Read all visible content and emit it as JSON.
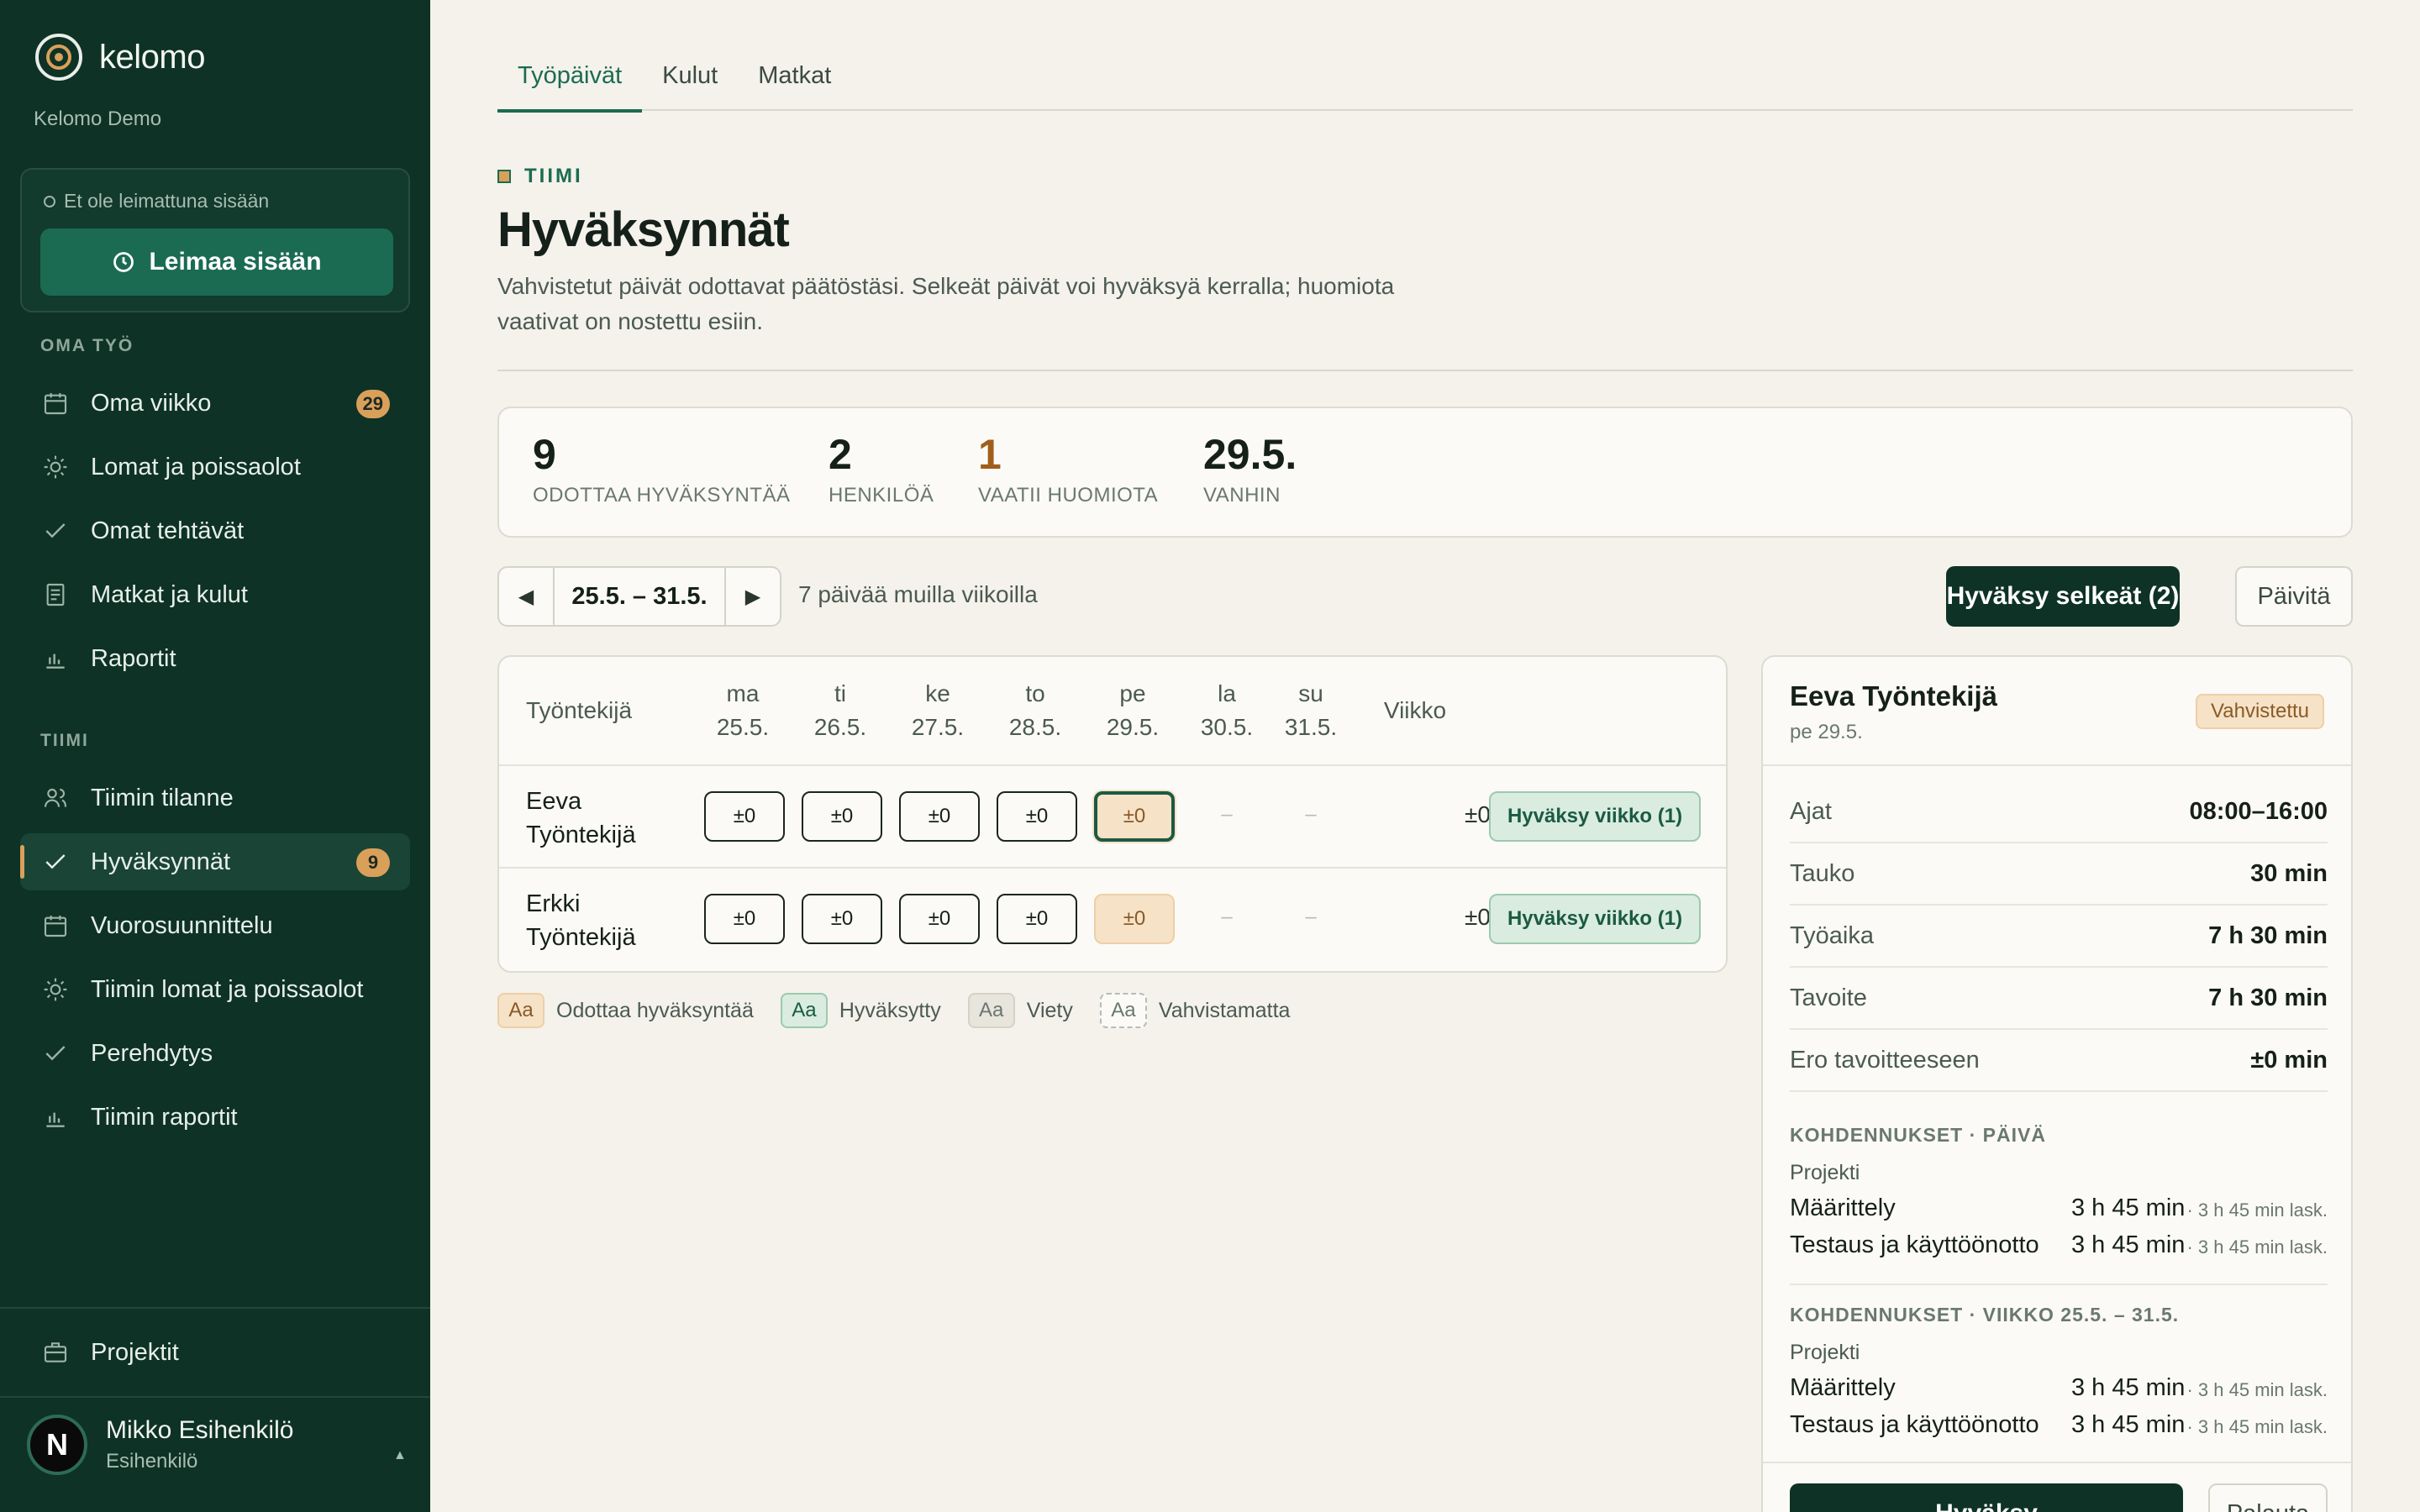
{
  "app": {
    "brand": "kelomo",
    "org": "Kelomo Demo"
  },
  "clock": {
    "status": "Et ole leimattuna sisään",
    "button": "Leimaa sisään"
  },
  "sidebar": {
    "section_own": "OMA TYÖ",
    "own_items": [
      {
        "label": "Oma viikko",
        "icon": "calendar-icon",
        "badge": "29"
      },
      {
        "label": "Lomat ja poissaolot",
        "icon": "sun-icon"
      },
      {
        "label": "Omat tehtävät",
        "icon": "check-icon"
      },
      {
        "label": "Matkat ja kulut",
        "icon": "receipt-icon"
      },
      {
        "label": "Raportit",
        "icon": "bar-chart-icon"
      }
    ],
    "section_team": "TIIMI",
    "team_items": [
      {
        "label": "Tiimin tilanne",
        "icon": "users-icon"
      },
      {
        "label": "Hyväksynnät",
        "icon": "check-icon",
        "badge": "9",
        "active": true
      },
      {
        "label": "Vuorosuunnittelu",
        "icon": "calendar-icon"
      },
      {
        "label": "Tiimin lomat ja poissaolot",
        "icon": "sun-icon"
      },
      {
        "label": "Perehdytys",
        "icon": "check-icon"
      },
      {
        "label": "Tiimin raportit",
        "icon": "bar-chart-icon"
      }
    ],
    "projects": {
      "label": "Projektit",
      "icon": "briefcase-icon"
    },
    "user": {
      "initial": "N",
      "name": "Mikko Esihenkilö",
      "role": "Esihenkilö",
      "caret": "▲"
    }
  },
  "tabs": [
    {
      "label": "Työpäivät",
      "active": true
    },
    {
      "label": "Kulut"
    },
    {
      "label": "Matkat"
    }
  ],
  "header": {
    "kicker": "TIIMI",
    "title": "Hyväksynnät",
    "description": "Vahvistetut päivät odottavat päätöstäsi. Selkeät päivät voi hyväksyä kerralla; huomiota vaativat on nostettu esiin."
  },
  "stats": [
    {
      "value": "9",
      "label": "ODOTTAA HYVÄKSYNTÄÄ"
    },
    {
      "value": "2",
      "label": "HENKILÖÄ"
    },
    {
      "value": "1",
      "label": "VAATII HUOMIOTA",
      "accent": "#a15d1a"
    },
    {
      "value": "29.5.",
      "label": "VANHIN"
    }
  ],
  "toolbar": {
    "prev": "◀",
    "range": "25.5. – 31.5.",
    "next": "▶",
    "other_weeks": "7 päivää muilla viikoilla",
    "approve_all": "Hyväksy selkeät (2)",
    "refresh": "Päivitä"
  },
  "table": {
    "employee_header": "Työntekijä",
    "days": [
      {
        "name": "ma",
        "date": "25.5."
      },
      {
        "name": "ti",
        "date": "26.5."
      },
      {
        "name": "ke",
        "date": "27.5."
      },
      {
        "name": "to",
        "date": "28.5."
      },
      {
        "name": "pe",
        "date": "29.5."
      },
      {
        "name": "la",
        "date": "30.5."
      },
      {
        "name": "su",
        "date": "31.5."
      }
    ],
    "week_header": "Viikko",
    "rows": [
      {
        "name_line1": "Eeva",
        "name_line2": "Työntekijä",
        "cells": [
          "±0",
          "±0",
          "±0",
          "±0",
          "±0",
          "–",
          "–"
        ],
        "week": "±0",
        "action": "Hyväksy viikko (1)"
      },
      {
        "name_line1": "Erkki",
        "name_line2": "Työntekijä",
        "cells": [
          "±0",
          "±0",
          "±0",
          "±0",
          "±0",
          "–",
          "–"
        ],
        "week": "±0",
        "action": "Hyväksy viikko (1)"
      }
    ]
  },
  "legend": [
    {
      "chip": "Aa",
      "label": "Odottaa hyväksyntää"
    },
    {
      "chip": "Aa",
      "label": "Hyväksytty"
    },
    {
      "chip": "Aa",
      "label": "Viety"
    },
    {
      "chip": "Aa",
      "label": "Vahvistamatta"
    }
  ],
  "detail": {
    "name": "Eeva Työntekijä",
    "date": "pe 29.5.",
    "status": "Vahvistettu",
    "rows": [
      {
        "key": "Ajat",
        "value": "08:00–16:00"
      },
      {
        "key": "Tauko",
        "value": "30 min"
      },
      {
        "key": "Työaika",
        "value": "7 h 30 min"
      },
      {
        "key": "Tavoite",
        "value": "7 h 30 min"
      },
      {
        "key": "Ero tavoitteeseen",
        "value": "±0 min"
      }
    ],
    "alloc_day": {
      "title": "KOHDENNUKSET · PÄIVÄ",
      "group": "Projekti",
      "lines": [
        {
          "name": "Määrittely",
          "amount": "3 h 45 min",
          "estimate": "· 3 h 45 min lask."
        },
        {
          "name": "Testaus ja käyttöönotto",
          "amount": "3 h 45 min",
          "estimate": "· 3 h 45 min lask."
        }
      ]
    },
    "alloc_week": {
      "title": "KOHDENNUKSET · VIIKKO 25.5. – 31.5.",
      "group": "Projekti",
      "lines": [
        {
          "name": "Määrittely",
          "amount": "3 h 45 min",
          "estimate": "· 3 h 45 min lask."
        },
        {
          "name": "Testaus ja käyttöönotto",
          "amount": "3 h 45 min",
          "estimate": "· 3 h 45 min lask."
        }
      ]
    },
    "approve": "Hyväksy",
    "return": "Palauta"
  }
}
